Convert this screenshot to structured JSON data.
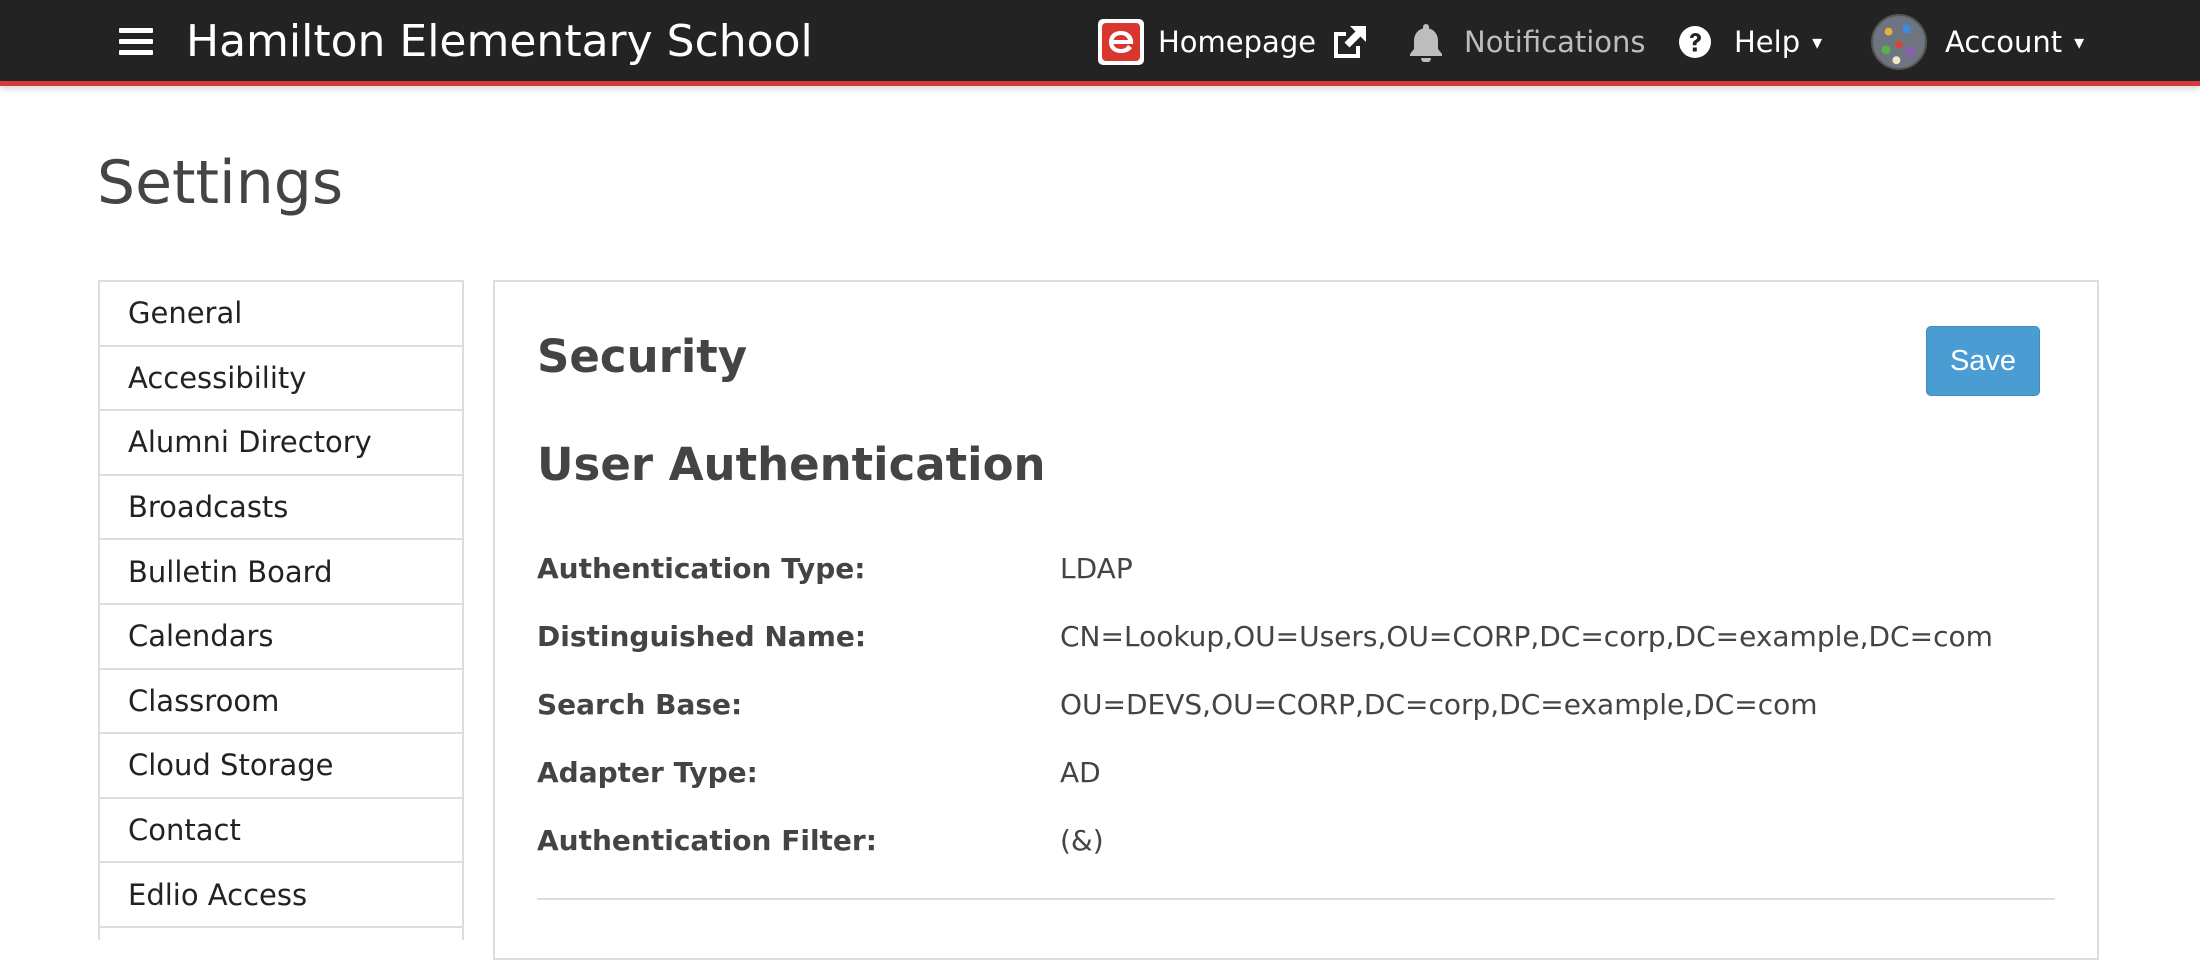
{
  "header": {
    "site_title": "Hamilton Elementary School",
    "menu_icon": "hamburger-menu-icon",
    "homepage": {
      "label": "Homepage",
      "logo_icon": "edlio-e-logo-icon",
      "external_icon": "external-link-icon"
    },
    "notifications": {
      "label": "Notifications",
      "icon": "bell-icon"
    },
    "help": {
      "label": "Help",
      "icon": "question-circle-icon",
      "caret": "▾"
    },
    "account": {
      "label": "Account",
      "icon": "avatar",
      "caret": "▾"
    },
    "accent_color": "#d23a3f",
    "background_color": "#232323"
  },
  "page": {
    "title": "Settings"
  },
  "sidebar": {
    "items": [
      {
        "label": "General"
      },
      {
        "label": "Accessibility"
      },
      {
        "label": "Alumni Directory"
      },
      {
        "label": "Broadcasts"
      },
      {
        "label": "Bulletin Board"
      },
      {
        "label": "Calendars"
      },
      {
        "label": "Classroom"
      },
      {
        "label": "Cloud Storage"
      },
      {
        "label": "Contact"
      },
      {
        "label": "Edlio Access"
      }
    ]
  },
  "panel": {
    "title": "Security",
    "save_label": "Save",
    "save_color": "#4a9dd2",
    "section_title": "User Authentication",
    "fields": [
      {
        "label": "Authentication Type:",
        "value": "LDAP"
      },
      {
        "label": "Distinguished Name:",
        "value": "CN=Lookup,OU=Users,OU=CORP,DC=corp,DC=example,DC=com"
      },
      {
        "label": "Search Base:",
        "value": "OU=DEVS,OU=CORP,DC=corp,DC=example,DC=com"
      },
      {
        "label": "Adapter Type:",
        "value": "AD"
      },
      {
        "label": "Authentication Filter:",
        "value": "(&)"
      }
    ]
  }
}
